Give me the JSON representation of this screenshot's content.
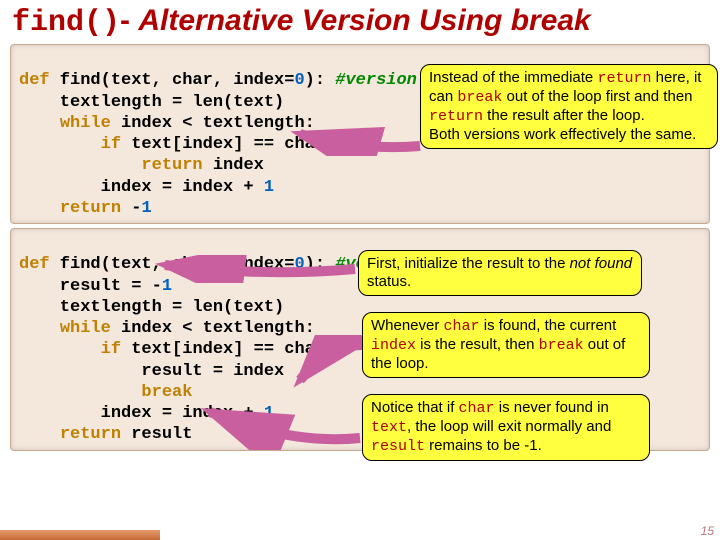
{
  "title": {
    "code": "find()",
    "sep": "- ",
    "rest_part1": "Alternative Version Using ",
    "rest_part2": "break"
  },
  "code1": {
    "l1a": "def",
    "l1b": " find(text, char, index=",
    "l1c": "0",
    "l1d": "): ",
    "l1e": "#version 1",
    "l2": "    textlength = len(text)",
    "l3a": "    ",
    "l3b": "while",
    "l3c": " index < textlength:",
    "l4a": "        ",
    "l4b": "if",
    "l4c": " text[index] == char:",
    "l5a": "            ",
    "l5b": "return",
    "l5c": " index",
    "l6a": "        index = index + ",
    "l6b": "1",
    "l7a": "    ",
    "l7b": "return",
    "l7c": " -",
    "l7d": "1"
  },
  "code2": {
    "l1a": "def",
    "l1b": " find(text, char, index=",
    "l1c": "0",
    "l1d": "): ",
    "l1e": "#version 2",
    "l2a": "    result = -",
    "l2b": "1",
    "l3": "    textlength = len(text)",
    "l4a": "    ",
    "l4b": "while",
    "l4c": " index < textlength:",
    "l5a": "        ",
    "l5b": "if",
    "l5c": " text[index] == char:",
    "l6": "            result = index",
    "l7a": "            ",
    "l7b": "break",
    "l8a": "        index = index + ",
    "l8b": "1",
    "l9a": "    ",
    "l9b": "return",
    "l9c": " result"
  },
  "callouts": {
    "c1_p1": "Instead of the immediate ",
    "c1_return": "return",
    "c1_p2": " here, it can ",
    "c1_break": "break",
    "c1_p3": " out of the loop first and then ",
    "c1_return2": "return",
    "c1_p4": " the result after the loop.",
    "c1_p5": "Both versions work effectively the same.",
    "c2_p1": "First, initialize the result to the ",
    "c2_nf": "not found",
    "c2_p2": " status.",
    "c3_p1": "Whenever ",
    "c3_char": "char",
    "c3_p2": " is found, the current ",
    "c3_index": "index",
    "c3_p3": " is the result, then ",
    "c3_break": "break",
    "c3_p4": " out of the loop.",
    "c4_p1": "Notice that if ",
    "c4_char": "char",
    "c4_p2": " is never found in ",
    "c4_text": "text",
    "c4_p3": ", the loop will exit normally and ",
    "c4_result": "result",
    "c4_p4": " remains to be -1."
  },
  "page_number": "15"
}
